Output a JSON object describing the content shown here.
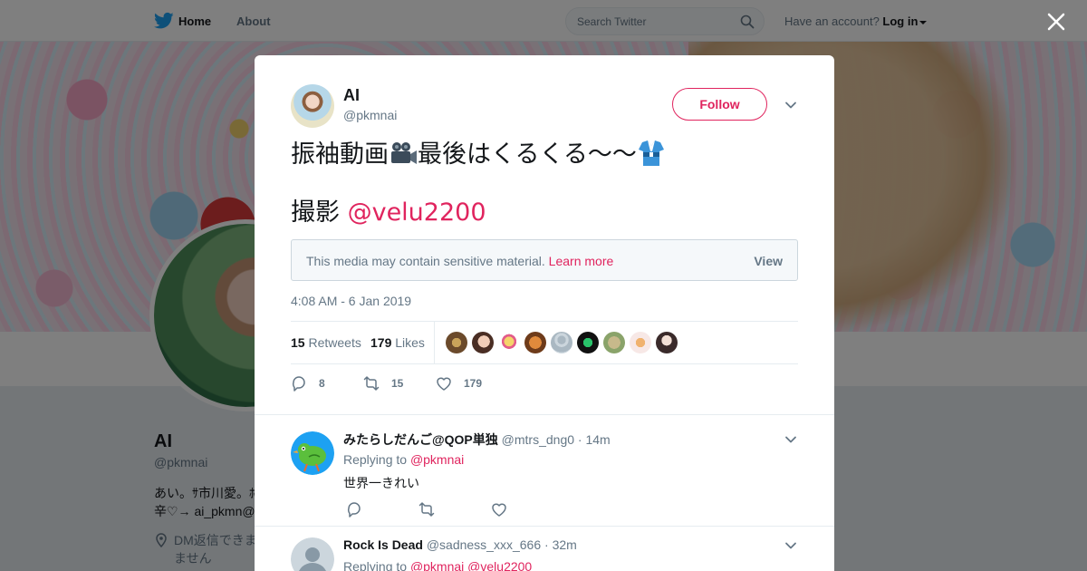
{
  "nav": {
    "home": "Home",
    "about": "About",
    "search_placeholder": "Search Twitter",
    "account_prompt": "Have an account?",
    "login": "Log in",
    "brand_color": "#1da1f2"
  },
  "profile": {
    "name": "AI",
    "handle": "@pkmnai",
    "bio_line1": "あい。ｻ市川愛。ﾎ",
    "bio_line2": "辛♡→ ai_pkmn@",
    "location_line1": "DM返信できま",
    "location_line2": "ません"
  },
  "tweet": {
    "author_name": "AI",
    "author_handle": "@pkmnai",
    "follow_label": "Follow",
    "text_line1_a": "振袖動画",
    "text_line1_b": "最後はくるくる〜〜",
    "text_line2_prefix": "撮影 ",
    "text_line2_mention": "@velu2200",
    "sensitive_notice": "This media may contain sensitive material.",
    "learn_more": "Learn more",
    "view_label": "View",
    "timestamp": "4:08 AM - 6 Jan 2019",
    "retweets_count": "15",
    "retweets_label": "Retweets",
    "likes_count": "179",
    "likes_label": "Likes",
    "reply_count": "8",
    "retweet_action_count": "15",
    "like_action_count": "179",
    "accent_color": "#e0245e"
  },
  "replies": [
    {
      "name": "みたらしだんご@QOP単独",
      "handle": "@mtrs_dng0",
      "time": "14m",
      "replying_to_label": "Replying to",
      "replying_to": "@pkmnai",
      "text": "世界一きれい"
    },
    {
      "name": "Rock Is Dead",
      "handle": "@sadness_xxx_666",
      "time": "32m",
      "replying_to_label": "Replying to",
      "replying_to": "@pkmnai",
      "replying_to_2": "@velu2200"
    }
  ]
}
